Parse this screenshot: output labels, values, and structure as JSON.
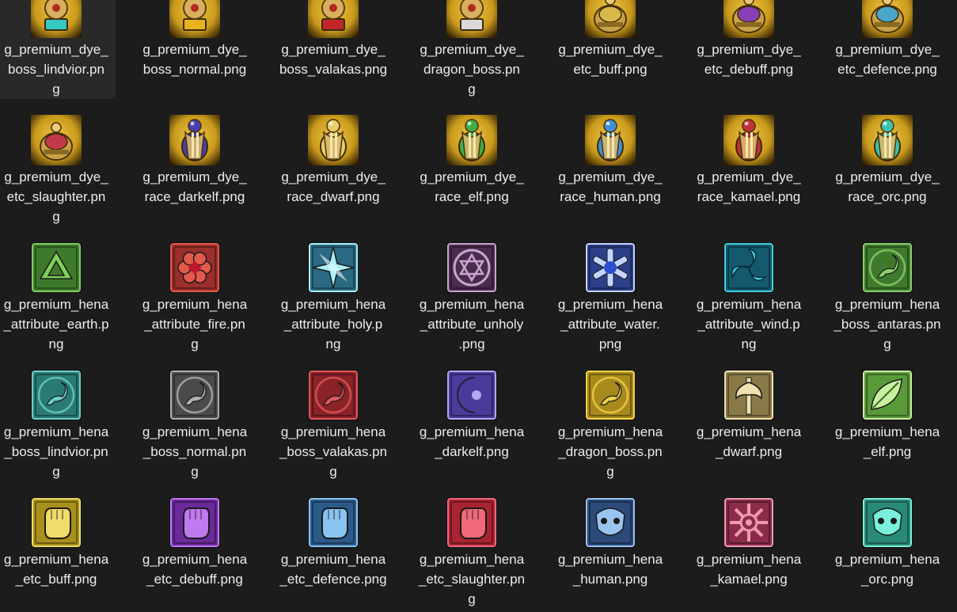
{
  "explorer": {
    "rows": [
      [
        {
          "icon": "dye-boss-lindvior-icon",
          "bg": "#c99a1c",
          "accent": "#35c9c4",
          "kind": "dye_boss",
          "lines": [
            "g_premium_dye_",
            "boss_lindvior.pn",
            "g"
          ]
        },
        {
          "icon": "dye-boss-normal-icon",
          "bg": "#c99a1c",
          "accent": "#e8b321",
          "kind": "dye_boss",
          "lines": [
            "g_premium_dye_",
            "boss_normal.png"
          ]
        },
        {
          "icon": "dye-boss-valakas-icon",
          "bg": "#c99a1c",
          "accent": "#c2262b",
          "kind": "dye_boss",
          "lines": [
            "g_premium_dye_",
            "boss_valakas.png"
          ]
        },
        {
          "icon": "dye-dragon-boss-icon",
          "bg": "#c99a1c",
          "accent": "#d9d9d9",
          "kind": "dye_boss",
          "lines": [
            "g_premium_dye_",
            "dragon_boss.pn",
            "g"
          ]
        },
        {
          "icon": "dye-etc-buff-icon",
          "bg": "#c99a1c",
          "accent": "#d8b84a",
          "kind": "dye_etc",
          "lines": [
            "g_premium_dye_",
            "etc_buff.png"
          ]
        },
        {
          "icon": "dye-etc-debuff-icon",
          "bg": "#c99a1c",
          "accent": "#8a3fb8",
          "kind": "dye_etc",
          "lines": [
            "g_premium_dye_",
            "etc_debuff.png"
          ]
        },
        {
          "icon": "dye-etc-defence-icon",
          "bg": "#c99a1c",
          "accent": "#4aa6c8",
          "kind": "dye_etc",
          "lines": [
            "g_premium_dye_",
            "etc_defence.png"
          ]
        }
      ],
      [
        {
          "icon": "dye-etc-slaughter-icon",
          "bg": "#c99a1c",
          "accent": "#c23a4a",
          "kind": "dye_etc",
          "lines": [
            "g_premium_dye_",
            "etc_slaughter.pn",
            "g"
          ]
        },
        {
          "icon": "dye-race-darkelf-icon",
          "bg": "#c99a1c",
          "accent": "#4a3fb0",
          "kind": "dye_race",
          "lines": [
            "g_premium_dye_",
            "race_darkelf.png"
          ]
        },
        {
          "icon": "dye-race-dwarf-icon",
          "bg": "#c99a1c",
          "accent": "#e8cf6a",
          "kind": "dye_race",
          "lines": [
            "g_premium_dye_",
            "race_dwarf.png"
          ]
        },
        {
          "icon": "dye-race-elf-icon",
          "bg": "#c99a1c",
          "accent": "#3fae4a",
          "kind": "dye_race",
          "lines": [
            "g_premium_dye_",
            "race_elf.png"
          ]
        },
        {
          "icon": "dye-race-human-icon",
          "bg": "#c99a1c",
          "accent": "#3f8fd8",
          "kind": "dye_race",
          "lines": [
            "g_premium_dye_",
            "race_human.png"
          ]
        },
        {
          "icon": "dye-race-kamael-icon",
          "bg": "#c99a1c",
          "accent": "#c2303a",
          "kind": "dye_race",
          "lines": [
            "g_premium_dye_",
            "race_kamael.png"
          ]
        },
        {
          "icon": "dye-race-orc-icon",
          "bg": "#c99a1c",
          "accent": "#3fc2b0",
          "kind": "dye_race",
          "lines": [
            "g_premium_dye_",
            "race_orc.png"
          ]
        }
      ],
      [
        {
          "icon": "hena-attribute-earth-icon",
          "bg": "#3f7a2c",
          "accent": "#7fd05a",
          "kind": "hena_tri",
          "lines": [
            "g_premium_hena",
            "_attribute_earth.p",
            "ng"
          ]
        },
        {
          "icon": "hena-attribute-fire-icon",
          "bg": "#9a2f2c",
          "accent": "#e35a4a",
          "kind": "hena_flower",
          "lines": [
            "g_premium_hena",
            "_attribute_fire.pn",
            "g"
          ]
        },
        {
          "icon": "hena-attribute-holy-icon",
          "bg": "#2c6a84",
          "accent": "#a9f0f5",
          "kind": "hena_star",
          "lines": [
            "g_premium_hena",
            "_attribute_holy.p",
            "ng"
          ]
        },
        {
          "icon": "hena-attribute-unholy-icon",
          "bg": "#4a2c4e",
          "accent": "#c9a6d0",
          "kind": "hena_hexa",
          "lines": [
            "g_premium_hena",
            "_attribute_unholy",
            ".png"
          ]
        },
        {
          "icon": "hena-attribute-water-icon",
          "bg": "#2c3f8a",
          "accent": "#c4d6ff",
          "kind": "hena_snow",
          "lines": [
            "g_premium_hena",
            "_attribute_water.",
            "png"
          ]
        },
        {
          "icon": "hena-attribute-wind-icon",
          "bg": "#14596e",
          "accent": "#3fd0e0",
          "kind": "hena_swirl",
          "lines": [
            "g_premium_hena",
            "_attribute_wind.p",
            "ng"
          ]
        },
        {
          "icon": "hena-boss-antaras-icon",
          "bg": "#3f7a2c",
          "accent": "#8ed070",
          "kind": "hena_dragon",
          "lines": [
            "g_premium_hena",
            "_boss_antaras.pn",
            "g"
          ]
        }
      ],
      [
        {
          "icon": "hena-boss-lindvior-icon",
          "bg": "#2a7a74",
          "accent": "#6ad0c4",
          "kind": "hena_dragon",
          "lines": [
            "g_premium_hena",
            "_boss_lindvior.pn",
            "g"
          ]
        },
        {
          "icon": "hena-boss-normal-icon",
          "bg": "#4a4a4a",
          "accent": "#b0b0b0",
          "kind": "hena_dragon",
          "lines": [
            "g_premium_hena",
            "_boss_normal.pn",
            "g"
          ]
        },
        {
          "icon": "hena-boss-valakas-icon",
          "bg": "#8a2228",
          "accent": "#e05a5a",
          "kind": "hena_dragon",
          "lines": [
            "g_premium_hena",
            "_boss_valakas.pn",
            "g"
          ]
        },
        {
          "icon": "hena-darkelf-icon",
          "bg": "#4a3a9a",
          "accent": "#b7a6f0",
          "kind": "hena_moon",
          "lines": [
            "g_premium_hena",
            "_darkelf.png"
          ]
        },
        {
          "icon": "hena-dragon-boss-icon",
          "bg": "#a88a1c",
          "accent": "#f0d24a",
          "kind": "hena_dragon",
          "lines": [
            "g_premium_hena",
            "_dragon_boss.pn",
            "g"
          ]
        },
        {
          "icon": "hena-dwarf-icon",
          "bg": "#8a7a4a",
          "accent": "#f0e2b0",
          "kind": "hena_axe",
          "lines": [
            "g_premium_hena",
            "_dwarf.png"
          ]
        },
        {
          "icon": "hena-elf-icon",
          "bg": "#5a9a3a",
          "accent": "#c9f0a0",
          "kind": "hena_leaf",
          "lines": [
            "g_premium_hena",
            "_elf.png"
          ]
        }
      ],
      [
        {
          "icon": "hena-etc-buff-icon",
          "bg": "#a8901c",
          "accent": "#f0dc6a",
          "kind": "hena_fist",
          "lines": [
            "g_premium_hena",
            "_etc_buff.png"
          ]
        },
        {
          "icon": "hena-etc-debuff-icon",
          "bg": "#6a2a9a",
          "accent": "#c07af0",
          "kind": "hena_fist",
          "lines": [
            "g_premium_hena",
            "_etc_debuff.png"
          ]
        },
        {
          "icon": "hena-etc-defence-icon",
          "bg": "#2c5a8a",
          "accent": "#8ac4f0",
          "kind": "hena_fist",
          "lines": [
            "g_premium_hena",
            "_etc_defence.png"
          ]
        },
        {
          "icon": "hena-etc-slaughter-icon",
          "bg": "#a82432",
          "accent": "#f06a7a",
          "kind": "hena_fist",
          "lines": [
            "g_premium_hena",
            "_etc_slaughter.pn",
            "g"
          ]
        },
        {
          "icon": "hena-human-icon",
          "bg": "#2c4a7a",
          "accent": "#9ac4f0",
          "kind": "hena_mask",
          "lines": [
            "g_premium_hena",
            "_human.png"
          ]
        },
        {
          "icon": "hena-kamael-icon",
          "bg": "#8a2c4a",
          "accent": "#f09ab0",
          "kind": "hena_sun",
          "lines": [
            "g_premium_hena",
            "_kamael.png"
          ]
        },
        {
          "icon": "hena-orc-icon",
          "bg": "#2a8a7a",
          "accent": "#7af0dc",
          "kind": "hena_mask",
          "lines": [
            "g_premium_hena",
            "_orc.png"
          ]
        }
      ]
    ]
  }
}
